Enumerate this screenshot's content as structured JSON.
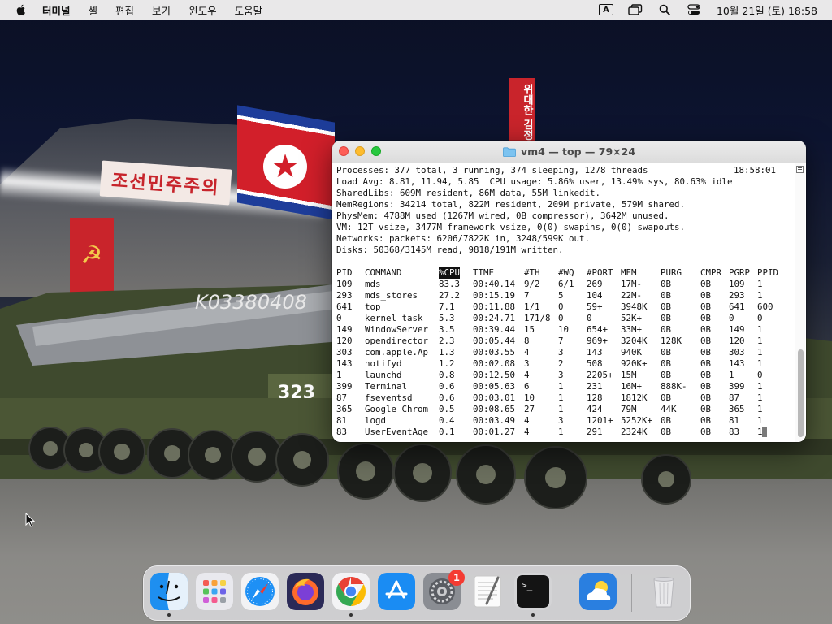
{
  "menubar": {
    "app_name": "터미널",
    "items": [
      "셸",
      "편집",
      "보기",
      "윈도우",
      "도움말"
    ],
    "input_indicator": "A",
    "clock": "10월 21일 (토) 18:58"
  },
  "wallpaper": {
    "sign_text": "조선민주주의",
    "banner_text": "위대한 김정",
    "vehicle_text": "K03380408",
    "badge_number": "323"
  },
  "terminal": {
    "title": "vm4 — top — 79×24",
    "summary_lines": [
      "Processes: 377 total, 3 running, 374 sleeping, 1278 threads",
      "Load Avg: 8.81, 11.94, 5.85  CPU usage: 5.86% user, 13.49% sys, 80.63% idle",
      "SharedLibs: 609M resident, 86M data, 55M linkedit.",
      "MemRegions: 34214 total, 822M resident, 209M private, 579M shared.",
      "PhysMem: 4788M used (1267M wired, 0B compressor), 3642M unused.",
      "VM: 12T vsize, 3477M framework vsize, 0(0) swapins, 0(0) swapouts.",
      "Networks: packets: 6206/7822K in, 3248/599K out.",
      "Disks: 50368/3145M read, 9818/191M written."
    ],
    "time": "18:58:01",
    "columns": [
      "PID",
      "COMMAND",
      "%CPU",
      "TIME",
      "#TH",
      "#WQ",
      "#PORT",
      "MEM",
      "PURG",
      "CMPR",
      "PGRP",
      "PPID"
    ],
    "highlight_column": "%CPU",
    "processes": [
      [
        "109",
        "mds",
        "83.3",
        "00:40.14",
        "9/2",
        "6/1",
        "269",
        "17M-",
        "0B",
        "0B",
        "109",
        "1"
      ],
      [
        "293",
        "mds_stores",
        "27.2",
        "00:15.19",
        "7",
        "5",
        "104",
        "22M-",
        "0B",
        "0B",
        "293",
        "1"
      ],
      [
        "641",
        "top",
        "7.1",
        "00:11.88",
        "1/1",
        "0",
        "59+",
        "3948K",
        "0B",
        "0B",
        "641",
        "600"
      ],
      [
        "0",
        "kernel_task",
        "5.3",
        "00:24.71",
        "171/8",
        "0",
        "0",
        "52K+",
        "0B",
        "0B",
        "0",
        "0"
      ],
      [
        "149",
        "WindowServer",
        "3.5",
        "00:39.44",
        "15",
        "10",
        "654+",
        "33M+",
        "0B",
        "0B",
        "149",
        "1"
      ],
      [
        "120",
        "opendirector",
        "2.3",
        "00:05.44",
        "8",
        "7",
        "969+",
        "3204K",
        "128K",
        "0B",
        "120",
        "1"
      ],
      [
        "303",
        "com.apple.Ap",
        "1.3",
        "00:03.55",
        "4",
        "3",
        "143",
        "940K",
        "0B",
        "0B",
        "303",
        "1"
      ],
      [
        "143",
        "notifyd",
        "1.2",
        "00:02.08",
        "3",
        "2",
        "508",
        "920K+",
        "0B",
        "0B",
        "143",
        "1"
      ],
      [
        "1",
        "launchd",
        "0.8",
        "00:12.50",
        "4",
        "3",
        "2205+",
        "15M",
        "0B",
        "0B",
        "1",
        "0"
      ],
      [
        "399",
        "Terminal",
        "0.6",
        "00:05.63",
        "6",
        "1",
        "231",
        "16M+",
        "888K-",
        "0B",
        "399",
        "1"
      ],
      [
        "87",
        "fseventsd",
        "0.6",
        "00:03.01",
        "10",
        "1",
        "128",
        "1812K",
        "0B",
        "0B",
        "87",
        "1"
      ],
      [
        "365",
        "Google Chrom",
        "0.5",
        "00:08.65",
        "27",
        "1",
        "424",
        "79M",
        "44K",
        "0B",
        "365",
        "1"
      ],
      [
        "81",
        "logd",
        "0.4",
        "00:03.49",
        "4",
        "3",
        "1201+",
        "5252K+",
        "0B",
        "0B",
        "81",
        "1"
      ],
      [
        "83",
        "UserEventAge",
        "0.1",
        "00:01.27",
        "4",
        "1",
        "291",
        "2324K",
        "0B",
        "0B",
        "83",
        "1"
      ]
    ]
  },
  "dock": {
    "apps": [
      {
        "name": "finder",
        "running": true
      },
      {
        "name": "launchpad",
        "running": false
      },
      {
        "name": "safari",
        "running": false
      },
      {
        "name": "firefox",
        "running": false
      },
      {
        "name": "chrome",
        "running": true
      },
      {
        "name": "app-store",
        "running": false
      },
      {
        "name": "system-settings",
        "running": false,
        "badge": "1"
      },
      {
        "name": "textedit",
        "running": false
      },
      {
        "name": "terminal",
        "running": true
      },
      {
        "name": "weather",
        "running": false
      },
      {
        "name": "trash",
        "running": false
      }
    ]
  },
  "colors": {
    "menubar_bg": "#e9e8e9",
    "terminal_bg": "#ffffff",
    "badge": "#f43b32",
    "close": "#fe5f57",
    "minimize": "#febc2e",
    "maximize": "#28c840"
  }
}
